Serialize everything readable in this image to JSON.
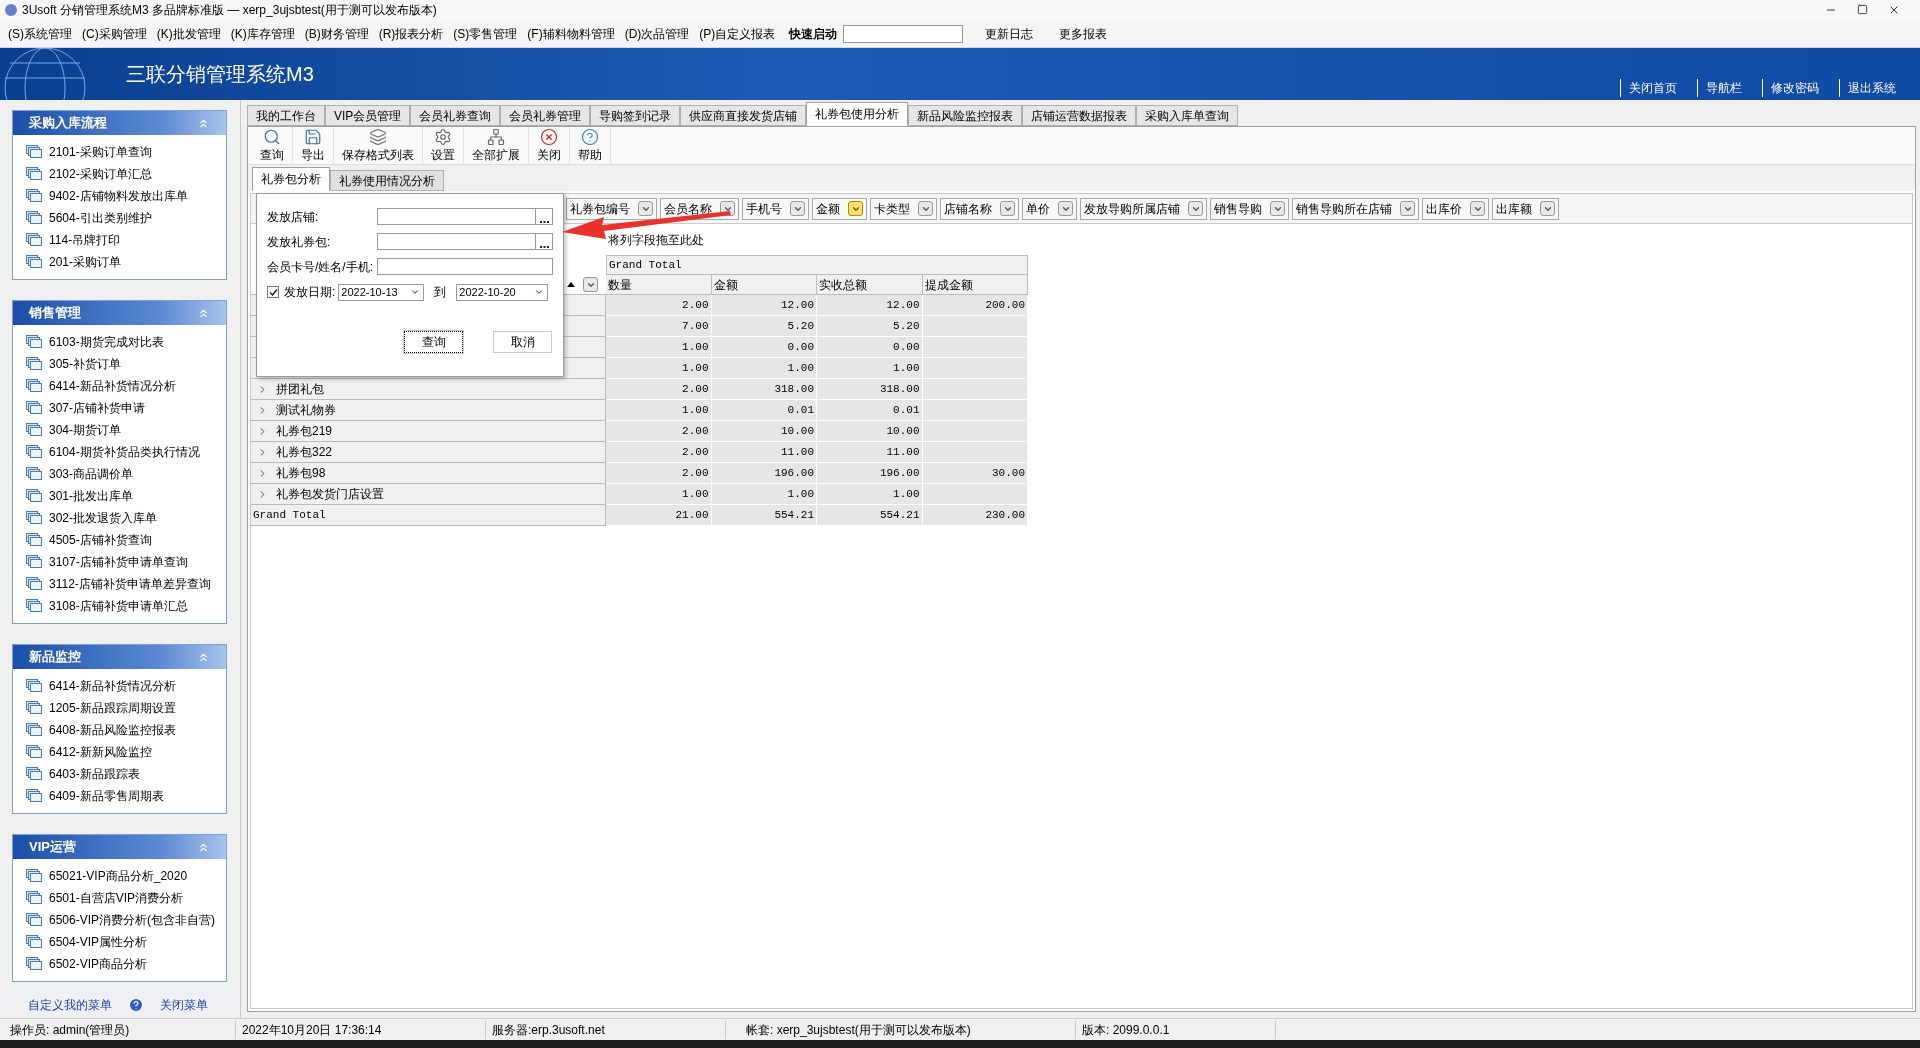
{
  "window": {
    "title": "3Usoft 分销管理系统M3 多品牌标准版 — xerp_3ujsbtest(用于测可以发布版本)"
  },
  "menu": [
    "(S)系统管理",
    "(C)采购管理",
    "(K)批发管理",
    "(K)库存管理",
    "(B)财务管理",
    "(R)报表分析",
    "(S)零售管理",
    "(F)辅料物料管理",
    "(D)次品管理",
    "(P)自定义报表"
  ],
  "quick_launch": {
    "label": "快速启动"
  },
  "menu_links": [
    "更新日志",
    "更多报表"
  ],
  "header": {
    "title": "三联分销管理系统M3",
    "links": [
      "关闭首页",
      "导航栏",
      "修改密码",
      "退出系统"
    ]
  },
  "sidebar": {
    "groups": [
      {
        "title": "采购入库流程",
        "expanded": true,
        "items": [
          "2101-采购订单查询",
          "2102-采购订单汇总",
          "9402-店铺物料发放出库单",
          "5604-引出类别维护",
          "114-吊牌打印",
          "201-采购订单"
        ]
      },
      {
        "title": "销售管理",
        "expanded": true,
        "items": [
          "6103-期货完成对比表",
          "305-补货订单",
          "6414-新品补货情况分析",
          "307-店铺补货申请",
          "304-期货订单",
          "6104-期货补货品类执行情况",
          "303-商品调价单",
          "301-批发出库单",
          "302-批发退货入库单",
          "4505-店铺补货查询",
          "3107-店铺补货申请单查询",
          "3112-店铺补货申请单差异查询",
          "3108-店铺补货申请单汇总"
        ]
      },
      {
        "title": "新品监控",
        "expanded": true,
        "items": [
          "6414-新品补货情况分析",
          "1205-新品跟踪周期设置",
          "6408-新品风险监控报表",
          "6412-新新风险监控",
          "6403-新品跟踪表",
          "6409-新品零售周期表"
        ]
      },
      {
        "title": "VIP运营",
        "expanded": true,
        "items": [
          "65021-VIP商品分析_2020",
          "6501-自营店VIP消费分析",
          "6506-VIP消费分析(包含非自营)",
          "6504-VIP属性分析",
          "6502-VIP商品分析"
        ]
      }
    ],
    "footer": [
      "自定义我的菜单",
      "关闭菜单"
    ]
  },
  "tabs": [
    {
      "label": "我的工作台",
      "selected": false
    },
    {
      "label": "VIP会员管理",
      "selected": false
    },
    {
      "label": "会员礼券查询",
      "selected": false
    },
    {
      "label": "会员礼券管理",
      "selected": false
    },
    {
      "label": "导购签到记录",
      "selected": false
    },
    {
      "label": "供应商直接发货店铺",
      "selected": false
    },
    {
      "label": "礼券包使用分析",
      "selected": true
    },
    {
      "label": "新品风险监控报表",
      "selected": false
    },
    {
      "label": "店铺运营数据报表",
      "selected": false
    },
    {
      "label": "采购入库单查询",
      "selected": false
    }
  ],
  "toolbar": [
    {
      "kind": "search",
      "label": "查询"
    },
    {
      "kind": "export",
      "label": "导出"
    },
    {
      "kind": "layout",
      "label": "保存格式列表"
    },
    {
      "kind": "settings",
      "label": "设置"
    },
    {
      "kind": "expand",
      "label": "全部扩展"
    },
    {
      "kind": "close",
      "label": "关闭"
    },
    {
      "kind": "help",
      "label": "帮助"
    }
  ],
  "sub_tabs": [
    {
      "label": "礼券包分析",
      "selected": true
    },
    {
      "label": "礼券使用情况分析",
      "selected": false
    }
  ],
  "filter_fields": [
    {
      "label": "礼券包编号",
      "filtered": false
    },
    {
      "label": "会员名称",
      "filtered": false
    },
    {
      "label": "手机号",
      "filtered": false
    },
    {
      "label": "金额",
      "filtered": true
    },
    {
      "label": "卡类型",
      "filtered": false
    },
    {
      "label": "店铺名称",
      "filtered": false
    },
    {
      "label": "单价",
      "filtered": false
    },
    {
      "label": "发放导购所属店铺",
      "filtered": false
    },
    {
      "label": "销售导购",
      "filtered": false
    },
    {
      "label": "销售导购所在店铺",
      "filtered": false
    },
    {
      "label": "出库价",
      "filtered": false
    },
    {
      "label": "出库额",
      "filtered": false
    }
  ],
  "column_drop_hint": "将列字段拖至此处",
  "dialog": {
    "fields": [
      {
        "label": "发放店铺:",
        "kind": "picker"
      },
      {
        "label": "发放礼券包:",
        "kind": "picker"
      },
      {
        "label": "会员卡号/姓名/手机:",
        "kind": "text"
      }
    ],
    "date": {
      "checked": true,
      "label": "发放日期:",
      "from": "2022-10-13",
      "separator": "到",
      "to": "2022-10-20"
    },
    "buttons": [
      "查询",
      "取消"
    ]
  },
  "pivot": {
    "column_header": "Grand Total",
    "columns": [
      "数量",
      "金额",
      "实收总额",
      "提成金额"
    ],
    "rows": [
      {
        "values": [
          "2.00",
          "12.00",
          "12.00",
          "200.00"
        ]
      },
      {
        "values": [
          "7.00",
          "5.20",
          "5.20"
        ]
      },
      {
        "values": [
          "1.00",
          "0.00",
          "0.00"
        ]
      },
      {
        "values": [
          "1.00",
          "1.00",
          "1.00"
        ]
      },
      {
        "label": "拼团礼包",
        "values": [
          "2.00",
          "318.00",
          "318.00"
        ]
      },
      {
        "label": "测试礼物券",
        "values": [
          "1.00",
          "0.01",
          "0.01"
        ]
      },
      {
        "label": "礼券包219",
        "values": [
          "2.00",
          "10.00",
          "10.00"
        ]
      },
      {
        "label": "礼券包322",
        "values": [
          "2.00",
          "11.00",
          "11.00"
        ]
      },
      {
        "label": "礼券包98",
        "values": [
          "2.00",
          "196.00",
          "196.00",
          "30.00"
        ]
      },
      {
        "label": "礼券包发货门店设置",
        "values": [
          "1.00",
          "1.00",
          "1.00"
        ]
      }
    ],
    "total": {
      "label": "Grand Total",
      "values": [
        "21.00",
        "554.21",
        "554.21",
        "230.00"
      ]
    }
  },
  "status_bar": [
    "操作员: admin(管理员)",
    "2022年10月20日 17:36:14",
    "服务器:erp.3usoft.net",
    "帐套: xerp_3ujsbtest(用于测可以发布版本)",
    "版本: 2099.0.0.1"
  ]
}
